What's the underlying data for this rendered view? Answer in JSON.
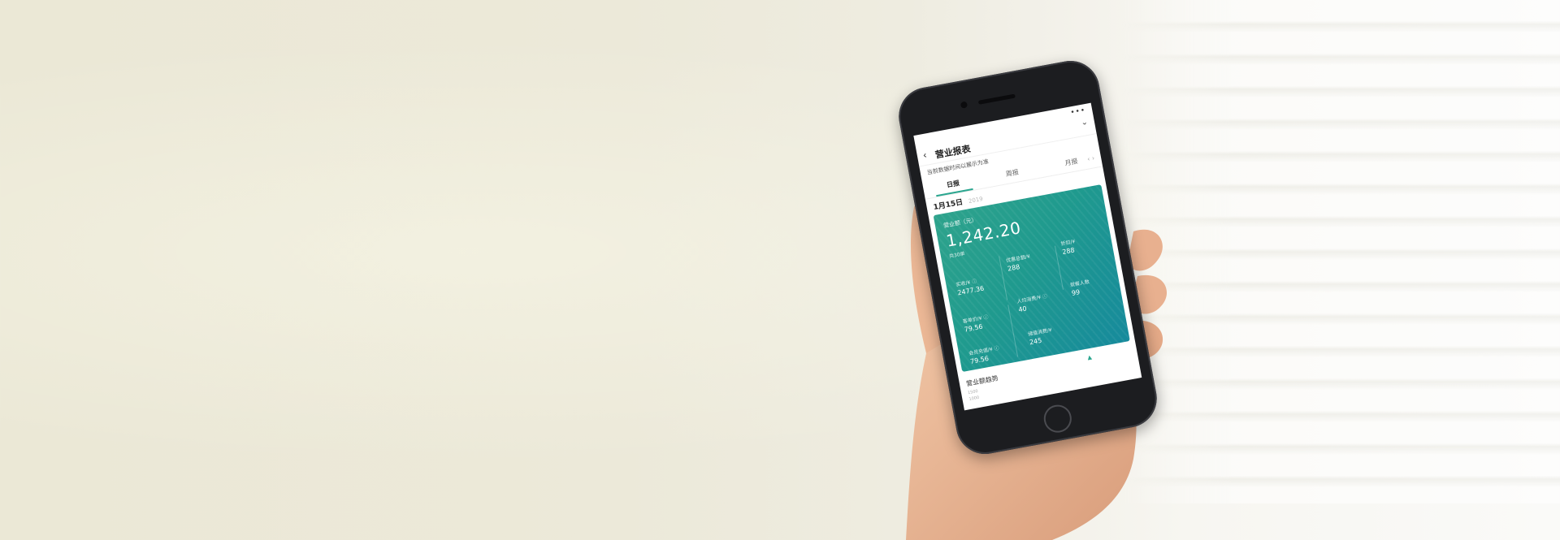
{
  "app": {
    "title": "营业报表",
    "notice": "当前数据时间以展示为准",
    "more_icon": "more-icon",
    "back_icon": "back-icon",
    "chevron_icon": "chevron-down-icon"
  },
  "tabs": [
    {
      "label": "日报",
      "active": true
    },
    {
      "label": "周报",
      "active": false
    },
    {
      "label": "月报",
      "active": false
    }
  ],
  "nav_arrows": "‹ ›",
  "date": {
    "day": "1月15日",
    "year": "2019"
  },
  "card": {
    "revenue_label": "营业额（元）",
    "revenue_value": "1,242.20",
    "revenue_sub": "共30单",
    "metrics": [
      {
        "label": "实收/¥",
        "value": "2477.36",
        "info": true
      },
      {
        "label": "优惠总额/¥",
        "value": "288",
        "info": false
      },
      {
        "label": "折扣/¥",
        "value": "288",
        "info": false
      },
      {
        "label": "客单价/¥",
        "value": "79.56",
        "info": true
      },
      {
        "label": "人均消费/¥",
        "value": "40",
        "info": true
      },
      {
        "label": "就餐人数",
        "value": "99",
        "info": false
      },
      {
        "label": "会员充值/¥",
        "value": "79.56",
        "info": true
      },
      {
        "label": "储值消费/¥",
        "value": "245",
        "info": false
      }
    ],
    "colors": {
      "start": "#2ea38c",
      "end": "#168a9c"
    }
  },
  "trend": {
    "title": "营业额趋势",
    "axis_ticks": [
      "1000",
      "1500"
    ]
  }
}
